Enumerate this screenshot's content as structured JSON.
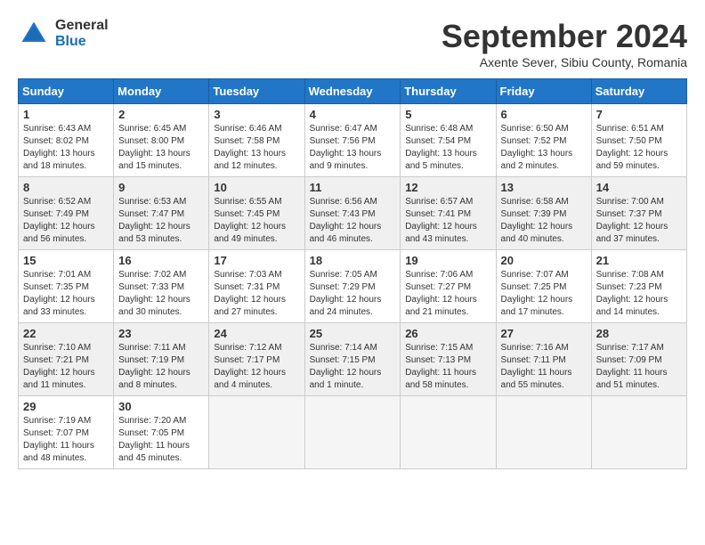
{
  "logo": {
    "general": "General",
    "blue": "Blue"
  },
  "title": "September 2024",
  "subtitle": "Axente Sever, Sibiu County, Romania",
  "days_header": [
    "Sunday",
    "Monday",
    "Tuesday",
    "Wednesday",
    "Thursday",
    "Friday",
    "Saturday"
  ],
  "weeks": [
    [
      {
        "day": "1",
        "info": "Sunrise: 6:43 AM\nSunset: 8:02 PM\nDaylight: 13 hours\nand 18 minutes."
      },
      {
        "day": "2",
        "info": "Sunrise: 6:45 AM\nSunset: 8:00 PM\nDaylight: 13 hours\nand 15 minutes."
      },
      {
        "day": "3",
        "info": "Sunrise: 6:46 AM\nSunset: 7:58 PM\nDaylight: 13 hours\nand 12 minutes."
      },
      {
        "day": "4",
        "info": "Sunrise: 6:47 AM\nSunset: 7:56 PM\nDaylight: 13 hours\nand 9 minutes."
      },
      {
        "day": "5",
        "info": "Sunrise: 6:48 AM\nSunset: 7:54 PM\nDaylight: 13 hours\nand 5 minutes."
      },
      {
        "day": "6",
        "info": "Sunrise: 6:50 AM\nSunset: 7:52 PM\nDaylight: 13 hours\nand 2 minutes."
      },
      {
        "day": "7",
        "info": "Sunrise: 6:51 AM\nSunset: 7:50 PM\nDaylight: 12 hours\nand 59 minutes."
      }
    ],
    [
      {
        "day": "8",
        "info": "Sunrise: 6:52 AM\nSunset: 7:49 PM\nDaylight: 12 hours\nand 56 minutes."
      },
      {
        "day": "9",
        "info": "Sunrise: 6:53 AM\nSunset: 7:47 PM\nDaylight: 12 hours\nand 53 minutes."
      },
      {
        "day": "10",
        "info": "Sunrise: 6:55 AM\nSunset: 7:45 PM\nDaylight: 12 hours\nand 49 minutes."
      },
      {
        "day": "11",
        "info": "Sunrise: 6:56 AM\nSunset: 7:43 PM\nDaylight: 12 hours\nand 46 minutes."
      },
      {
        "day": "12",
        "info": "Sunrise: 6:57 AM\nSunset: 7:41 PM\nDaylight: 12 hours\nand 43 minutes."
      },
      {
        "day": "13",
        "info": "Sunrise: 6:58 AM\nSunset: 7:39 PM\nDaylight: 12 hours\nand 40 minutes."
      },
      {
        "day": "14",
        "info": "Sunrise: 7:00 AM\nSunset: 7:37 PM\nDaylight: 12 hours\nand 37 minutes."
      }
    ],
    [
      {
        "day": "15",
        "info": "Sunrise: 7:01 AM\nSunset: 7:35 PM\nDaylight: 12 hours\nand 33 minutes."
      },
      {
        "day": "16",
        "info": "Sunrise: 7:02 AM\nSunset: 7:33 PM\nDaylight: 12 hours\nand 30 minutes."
      },
      {
        "day": "17",
        "info": "Sunrise: 7:03 AM\nSunset: 7:31 PM\nDaylight: 12 hours\nand 27 minutes."
      },
      {
        "day": "18",
        "info": "Sunrise: 7:05 AM\nSunset: 7:29 PM\nDaylight: 12 hours\nand 24 minutes."
      },
      {
        "day": "19",
        "info": "Sunrise: 7:06 AM\nSunset: 7:27 PM\nDaylight: 12 hours\nand 21 minutes."
      },
      {
        "day": "20",
        "info": "Sunrise: 7:07 AM\nSunset: 7:25 PM\nDaylight: 12 hours\nand 17 minutes."
      },
      {
        "day": "21",
        "info": "Sunrise: 7:08 AM\nSunset: 7:23 PM\nDaylight: 12 hours\nand 14 minutes."
      }
    ],
    [
      {
        "day": "22",
        "info": "Sunrise: 7:10 AM\nSunset: 7:21 PM\nDaylight: 12 hours\nand 11 minutes."
      },
      {
        "day": "23",
        "info": "Sunrise: 7:11 AM\nSunset: 7:19 PM\nDaylight: 12 hours\nand 8 minutes."
      },
      {
        "day": "24",
        "info": "Sunrise: 7:12 AM\nSunset: 7:17 PM\nDaylight: 12 hours\nand 4 minutes."
      },
      {
        "day": "25",
        "info": "Sunrise: 7:14 AM\nSunset: 7:15 PM\nDaylight: 12 hours\nand 1 minute."
      },
      {
        "day": "26",
        "info": "Sunrise: 7:15 AM\nSunset: 7:13 PM\nDaylight: 11 hours\nand 58 minutes."
      },
      {
        "day": "27",
        "info": "Sunrise: 7:16 AM\nSunset: 7:11 PM\nDaylight: 11 hours\nand 55 minutes."
      },
      {
        "day": "28",
        "info": "Sunrise: 7:17 AM\nSunset: 7:09 PM\nDaylight: 11 hours\nand 51 minutes."
      }
    ],
    [
      {
        "day": "29",
        "info": "Sunrise: 7:19 AM\nSunset: 7:07 PM\nDaylight: 11 hours\nand 48 minutes."
      },
      {
        "day": "30",
        "info": "Sunrise: 7:20 AM\nSunset: 7:05 PM\nDaylight: 11 hours\nand 45 minutes."
      },
      {
        "day": "",
        "info": ""
      },
      {
        "day": "",
        "info": ""
      },
      {
        "day": "",
        "info": ""
      },
      {
        "day": "",
        "info": ""
      },
      {
        "day": "",
        "info": ""
      }
    ]
  ]
}
